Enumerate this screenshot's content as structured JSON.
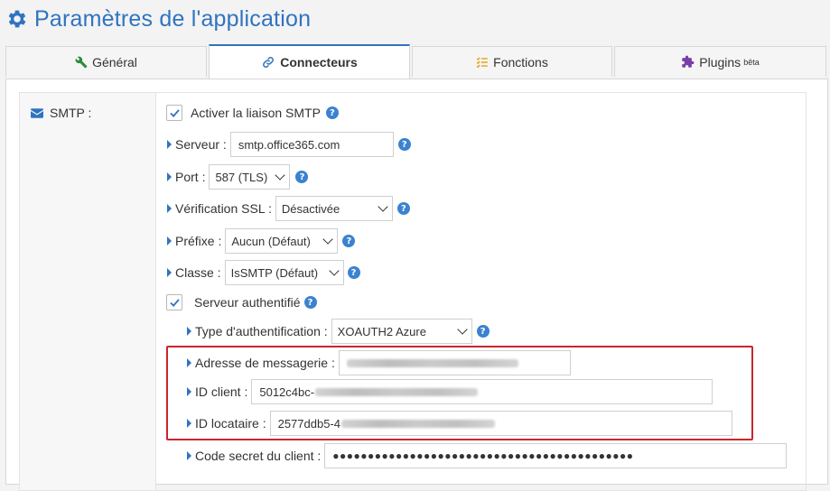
{
  "header": {
    "title": "Paramètres de l'application"
  },
  "tabs": [
    {
      "label": "Général",
      "icon": "wrench-icon",
      "color": "#2e8b3a"
    },
    {
      "label": "Connecteurs",
      "icon": "link-icon",
      "color": "#2f74c0",
      "active": true
    },
    {
      "label": "Fonctions",
      "icon": "checklist-icon",
      "color": "#e6a21a"
    },
    {
      "label": "Plugins",
      "icon": "puzzle-icon",
      "color": "#7a3ea8",
      "badge": "bêta"
    }
  ],
  "section": {
    "label": "SMTP :"
  },
  "form": {
    "enable_smtp": {
      "label": "Activer la liaison SMTP",
      "checked": true
    },
    "server": {
      "label": "Serveur :",
      "value": "smtp.office365.com"
    },
    "port": {
      "label": "Port :",
      "value": "587 (TLS)"
    },
    "ssl": {
      "label": "Vérification SSL :",
      "value": "Désactivée"
    },
    "prefix": {
      "label": "Préfixe :",
      "value": "Aucun (Défaut)"
    },
    "class": {
      "label": "Classe :",
      "value": "IsSMTP (Défaut)"
    },
    "auth_server": {
      "label": "Serveur authentifié",
      "checked": true
    },
    "auth_type": {
      "label": "Type d'authentification :",
      "value": "XOAUTH2 Azure"
    },
    "email": {
      "label": "Adresse de messagerie :"
    },
    "client_id": {
      "label": "ID client :",
      "value": "5012c4bc-"
    },
    "tenant_id": {
      "label": "ID locataire :",
      "value": "2577ddb5-4"
    },
    "client_secret": {
      "label": "Code secret du client :",
      "value": "●●●●●●●●●●●●●●●●●●●●●●●●●●●●●●●●●●●●●●●●●●●"
    }
  },
  "help_glyph": "?",
  "colors": {
    "accent": "#2f74c0",
    "highlight": "#c9262b"
  }
}
